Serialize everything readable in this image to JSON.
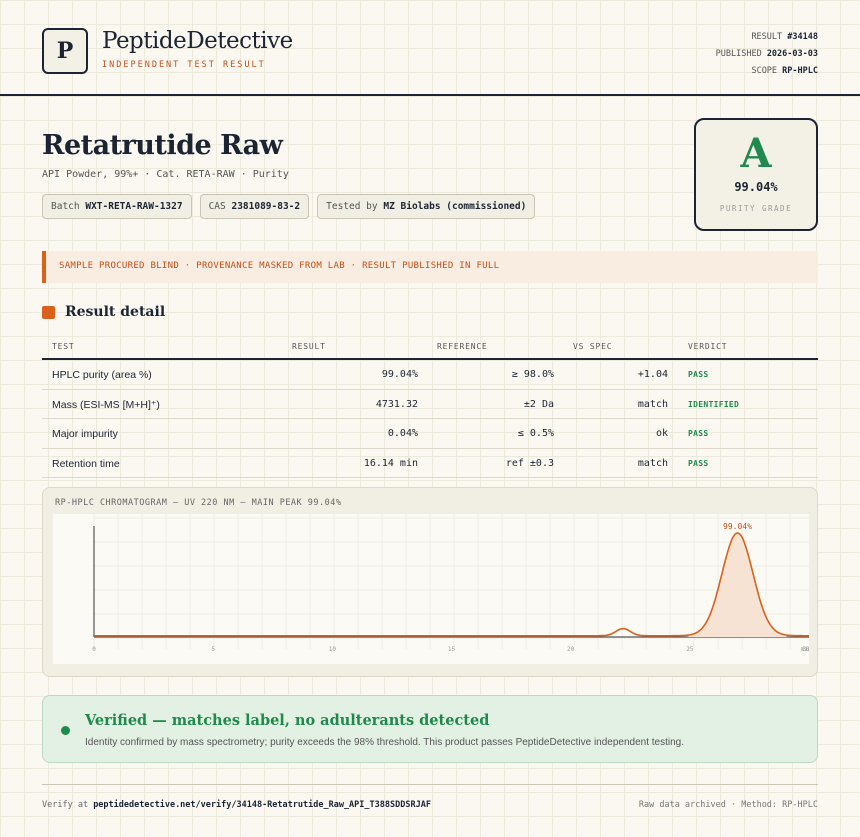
{
  "brand": {
    "logo_letter": "P",
    "name": "PeptideDetective",
    "tagline": "INDEPENDENT TEST RESULT"
  },
  "meta": {
    "result_label": "RESULT",
    "result_value": "#34148",
    "published_label": "PUBLISHED",
    "published_value": "2026-03-03",
    "scope_label": "SCOPE",
    "scope_value": "RP-HPLC"
  },
  "product": {
    "title": "Retatrutide Raw",
    "subtitle": "API Powder, 99%+ · Cat. RETA-RAW · Purity",
    "chips": [
      {
        "label": "Batch",
        "value": "WXT-RETA-RAW-1327"
      },
      {
        "label": "CAS",
        "value": "2381089-83-2"
      },
      {
        "label": "Tested by",
        "value": "MZ Biolabs (commissioned)"
      }
    ]
  },
  "grade": {
    "letter": "A",
    "value": "99.04%",
    "label": "PURITY GRADE"
  },
  "notice": "SAMPLE PROCURED BLIND · PROVENANCE MASKED FROM LAB · RESULT PUBLISHED IN FULL",
  "section_title": "Result detail",
  "table": {
    "headers": [
      "TEST",
      "RESULT",
      "REFERENCE",
      "VS SPEC",
      "VERDICT"
    ],
    "rows": [
      {
        "test": "HPLC purity (area %)",
        "result": "99.04%",
        "reference": "≥ 98.0%",
        "spec": "+1.04",
        "verdict": "PASS"
      },
      {
        "test": "Mass (ESI-MS [M+H]⁺)",
        "result": "4731.32",
        "reference": "±2 Da",
        "spec": "match",
        "verdict": "IDENTIFIED"
      },
      {
        "test": "Major impurity",
        "result": "0.04%",
        "reference": "≤ 0.5%",
        "spec": "ok",
        "verdict": "PASS"
      },
      {
        "test": "Retention time",
        "result": "16.14 min",
        "reference": "ref ±0.3",
        "spec": "match",
        "verdict": "PASS"
      }
    ]
  },
  "chart_title": "RP-HPLC CHROMATOGRAM — UV 220 NM — MAIN PEAK 99.04%",
  "chart_data": {
    "type": "line",
    "title": "RP-HPLC CHROMATOGRAM — UV 220 NM — MAIN PEAK 99.04%",
    "xlabel": "",
    "ylabel": "",
    "x_ticks": [
      "0",
      "5",
      "10",
      "15",
      "20",
      "25",
      "30"
    ],
    "x_end_label": "min",
    "xlim": [
      0,
      30
    ],
    "ylim": [
      0,
      1.08
    ],
    "peaks": [
      {
        "center": 22.2,
        "width": 0.3,
        "height": 0.07
      },
      {
        "center": 27.0,
        "width": 0.65,
        "height": 1.0
      }
    ],
    "main_peak_label": "99.04%",
    "line_color": "#d9611c",
    "fill_color": "#f7e3d3",
    "grid": true
  },
  "verified": {
    "title": "Verified — matches label, no adulterants detected",
    "description": "Identity confirmed by mass spectrometry; purity exceeds the 98% threshold. This product passes PeptideDetective independent testing."
  },
  "footer": {
    "verify_label": "Verify at",
    "verify_url": "peptidedetective.net/verify/34148-Retatrutide_Raw_API_T388SDDSRJAF",
    "right_text": "Raw data archived · Method: RP-HPLC"
  },
  "colors": {
    "accent": "#d9611c",
    "pass": "#1f8a4c",
    "ink": "#1c2433"
  }
}
